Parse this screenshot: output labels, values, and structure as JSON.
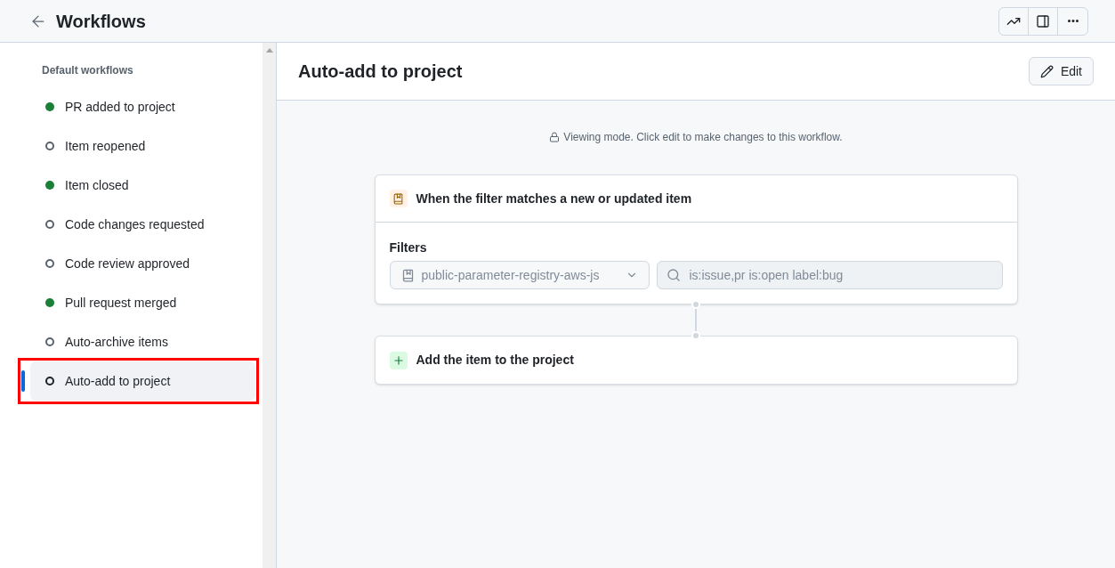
{
  "header": {
    "title": "Workflows"
  },
  "sidebar": {
    "heading": "Default workflows",
    "items": [
      {
        "label": "PR added to project",
        "on": true,
        "selected": false,
        "highlighted": false
      },
      {
        "label": "Item reopened",
        "on": false,
        "selected": false,
        "highlighted": false
      },
      {
        "label": "Item closed",
        "on": true,
        "selected": false,
        "highlighted": false
      },
      {
        "label": "Code changes requested",
        "on": false,
        "selected": false,
        "highlighted": false
      },
      {
        "label": "Code review approved",
        "on": false,
        "selected": false,
        "highlighted": false
      },
      {
        "label": "Pull request merged",
        "on": true,
        "selected": false,
        "highlighted": false
      },
      {
        "label": "Auto-archive items",
        "on": false,
        "selected": false,
        "highlighted": false
      },
      {
        "label": "Auto-add to project",
        "on": false,
        "selected": true,
        "highlighted": true
      }
    ]
  },
  "main": {
    "title": "Auto-add to project",
    "edit_button": "Edit",
    "notice": "Viewing mode. Click edit to make changes to this workflow.",
    "trigger_card": {
      "title": "When the filter matches a new or updated item",
      "filters_label": "Filters",
      "repository": "public-parameter-registry-aws-js",
      "query": "is:issue,pr is:open label:bug"
    },
    "action_card": {
      "title": "Add the item to the project"
    }
  }
}
